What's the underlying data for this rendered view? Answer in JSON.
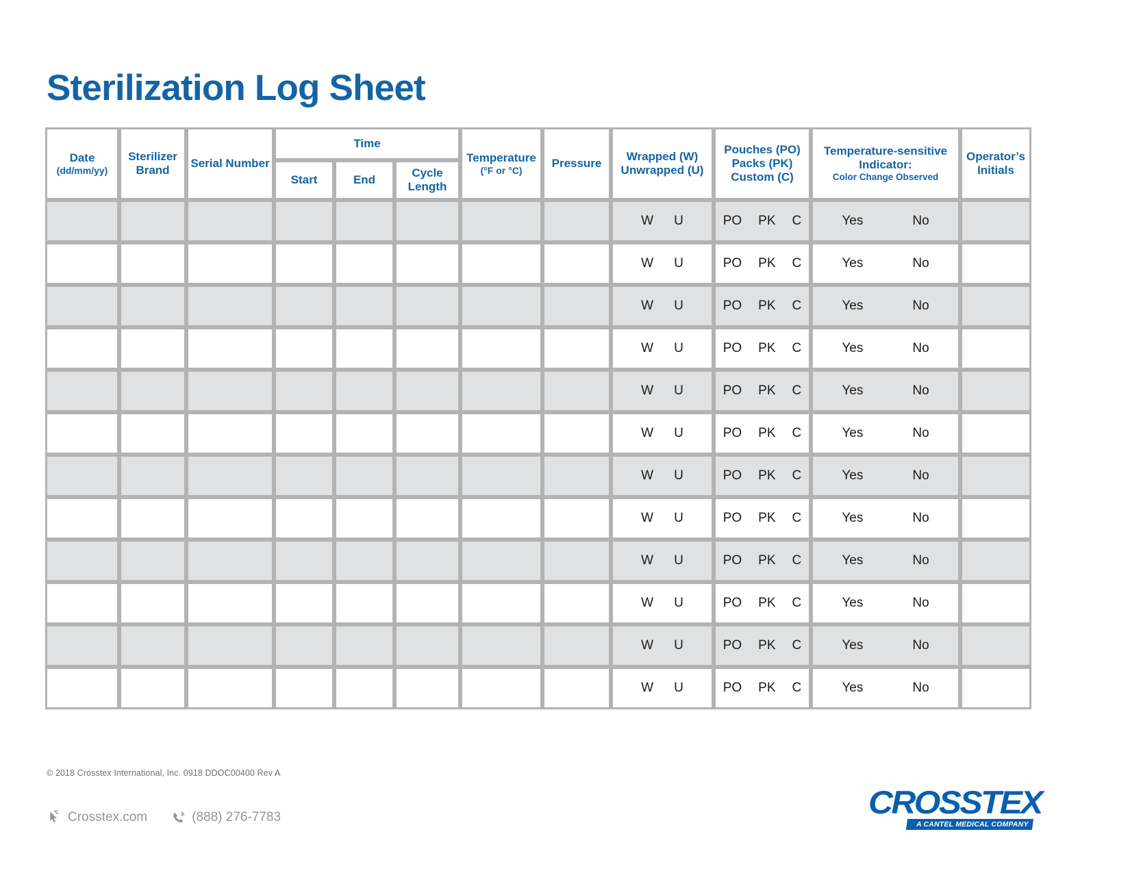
{
  "document": {
    "title": "Sterilization Log Sheet",
    "accent_color": "#1464a5",
    "shade_color": "#e0e1e2",
    "border_color": "#b3b3b3"
  },
  "table": {
    "headers": {
      "date": "Date",
      "date_sub": "(dd/mm/yy)",
      "sterilizer_brand_line1": "Sterilizer",
      "sterilizer_brand_line2": "Brand",
      "serial_number_line1": "Serial",
      "serial_number_line2": "Number",
      "time_group": "Time",
      "time_start": "Start",
      "time_end": "End",
      "time_cycle_line1": "Cycle",
      "time_cycle_line2": "Length",
      "temperature": "Temperature",
      "temperature_sub": "(°F or °C)",
      "pressure": "Pressure",
      "wrapped_line1": "Wrapped (W)",
      "wrapped_line2": "Unwrapped (U)",
      "pouches_line1": "Pouches (PO)",
      "pouches_line2": "Packs (PK)",
      "pouches_line3": "Custom (C)",
      "tsi_line1": "Temperature-sensitive",
      "tsi_line2": "Indicator:",
      "tsi_line3": "Color Change Observed",
      "operator_line1": "Operator’s",
      "operator_line2": "Initials"
    },
    "cell_options": {
      "wrapped": [
        "W",
        "U"
      ],
      "pouches": [
        "PO",
        "PK",
        "C"
      ],
      "indicator": [
        "Yes",
        "No"
      ]
    },
    "row_count": 12,
    "rows": [
      {
        "shaded": true,
        "wrapped": [
          "W",
          "U"
        ],
        "pouches": [
          "PO",
          "PK",
          "C"
        ],
        "indicator": [
          "Yes",
          "No"
        ]
      },
      {
        "shaded": false,
        "wrapped": [
          "W",
          "U"
        ],
        "pouches": [
          "PO",
          "PK",
          "C"
        ],
        "indicator": [
          "Yes",
          "No"
        ]
      },
      {
        "shaded": true,
        "wrapped": [
          "W",
          "U"
        ],
        "pouches": [
          "PO",
          "PK",
          "C"
        ],
        "indicator": [
          "Yes",
          "No"
        ]
      },
      {
        "shaded": false,
        "wrapped": [
          "W",
          "U"
        ],
        "pouches": [
          "PO",
          "PK",
          "C"
        ],
        "indicator": [
          "Yes",
          "No"
        ]
      },
      {
        "shaded": true,
        "wrapped": [
          "W",
          "U"
        ],
        "pouches": [
          "PO",
          "PK",
          "C"
        ],
        "indicator": [
          "Yes",
          "No"
        ]
      },
      {
        "shaded": false,
        "wrapped": [
          "W",
          "U"
        ],
        "pouches": [
          "PO",
          "PK",
          "C"
        ],
        "indicator": [
          "Yes",
          "No"
        ]
      },
      {
        "shaded": true,
        "wrapped": [
          "W",
          "U"
        ],
        "pouches": [
          "PO",
          "PK",
          "C"
        ],
        "indicator": [
          "Yes",
          "No"
        ]
      },
      {
        "shaded": false,
        "wrapped": [
          "W",
          "U"
        ],
        "pouches": [
          "PO",
          "PK",
          "C"
        ],
        "indicator": [
          "Yes",
          "No"
        ]
      },
      {
        "shaded": true,
        "wrapped": [
          "W",
          "U"
        ],
        "pouches": [
          "PO",
          "PK",
          "C"
        ],
        "indicator": [
          "Yes",
          "No"
        ]
      },
      {
        "shaded": false,
        "wrapped": [
          "W",
          "U"
        ],
        "pouches": [
          "PO",
          "PK",
          "C"
        ],
        "indicator": [
          "Yes",
          "No"
        ]
      },
      {
        "shaded": true,
        "wrapped": [
          "W",
          "U"
        ],
        "pouches": [
          "PO",
          "PK",
          "C"
        ],
        "indicator": [
          "Yes",
          "No"
        ]
      },
      {
        "shaded": false,
        "wrapped": [
          "W",
          "U"
        ],
        "pouches": [
          "PO",
          "PK",
          "C"
        ],
        "indicator": [
          "Yes",
          "No"
        ]
      }
    ]
  },
  "copyright": "© 2018 Crosstex International, Inc.   0918 DDOC00400 Rev A",
  "footer": {
    "website": "Crosstex.com",
    "phone": "(888) 276-7783",
    "website_icon": "cursor-click-icon",
    "phone_icon": "phone-icon"
  },
  "logo": {
    "wordmark": "CROSSTEX",
    "tagline": "A CANTEL MEDICAL COMPANY",
    "color": "#0a5fae"
  }
}
